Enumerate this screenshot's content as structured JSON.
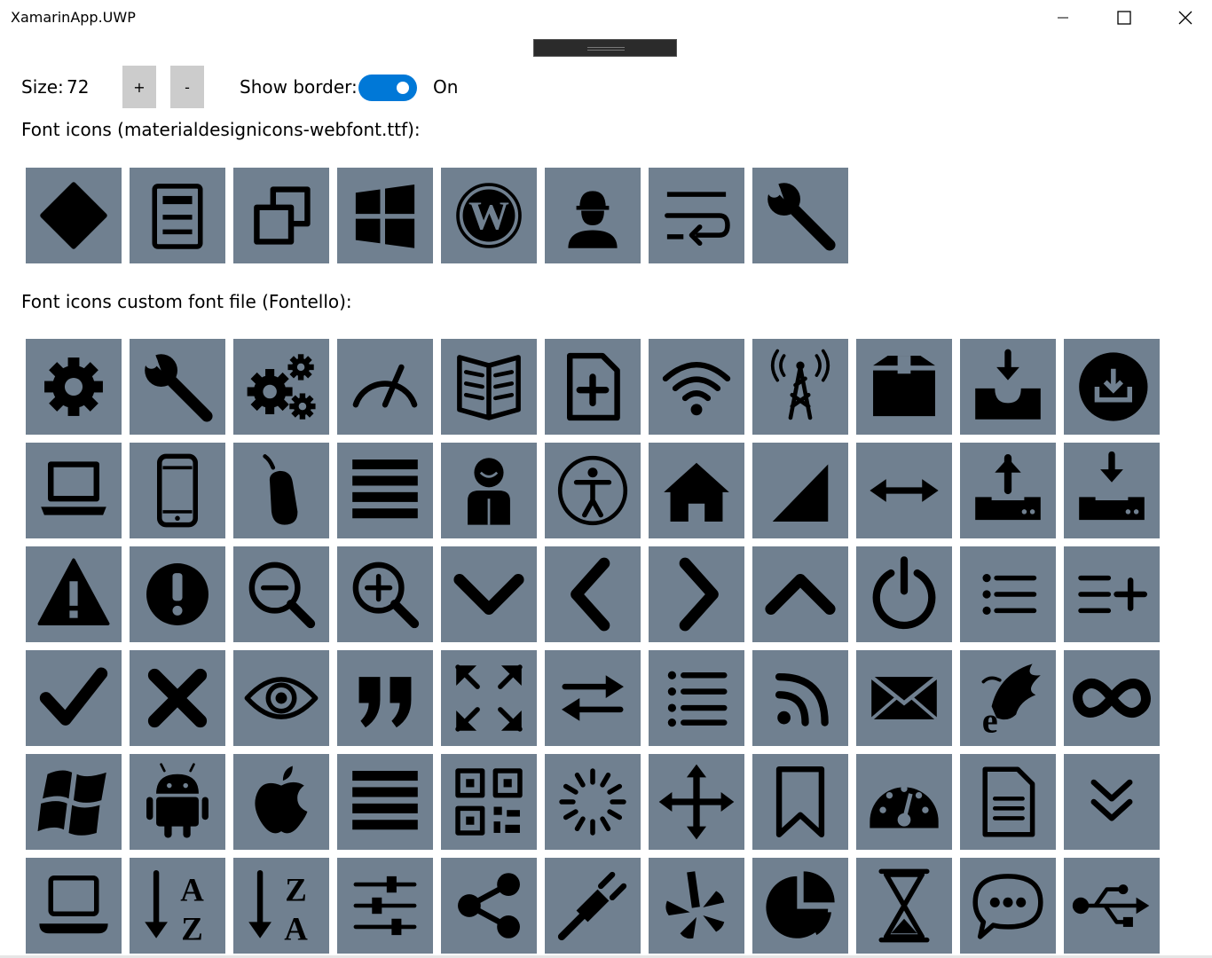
{
  "window": {
    "title": "XamarinApp.UWP"
  },
  "controls": {
    "size_label": "Size:",
    "size_value": "72",
    "plus_label": "+",
    "minus_label": "-",
    "border_label": "Show border:",
    "toggle_state": "On"
  },
  "sections": {
    "material_label": "Font icons (materialdesignicons-webfont.ttf):",
    "fontello_label": "Font icons custom font file (Fontello):"
  },
  "colors": {
    "tile_bg": "#708090",
    "toggle_on": "#0078d7",
    "icon": "#000000"
  },
  "material_icons": [
    "diamond",
    "locker",
    "window-restore",
    "windows",
    "wordpress",
    "worker",
    "wrap",
    "wrench"
  ],
  "fontello_icons": [
    [
      "cog",
      "wrench",
      "cogs",
      "gauge",
      "book-open",
      "doc-add",
      "wifi",
      "antenna",
      "box",
      "download-tray",
      "download-circle"
    ],
    [
      "laptop",
      "mobile",
      "mouse",
      "menu",
      "user",
      "accessibility",
      "home",
      "signal",
      "resize-horizontal",
      "upload-drive",
      "download-drive"
    ],
    [
      "warning",
      "exclamation",
      "zoom-out",
      "zoom-in",
      "chevron-down",
      "chevron-left",
      "chevron-right",
      "chevron-up",
      "power",
      "list",
      "list-add"
    ],
    [
      "check",
      "cancel",
      "eye",
      "quote",
      "fullscreen",
      "exchange",
      "list-bullets",
      "rss",
      "mail",
      "ie",
      "infinity"
    ],
    [
      "windows",
      "android",
      "apple",
      "menu-bars",
      "qrcode",
      "spinner",
      "move",
      "bookmark",
      "dashboard",
      "doc-text",
      "double-chevron-down"
    ],
    [
      "laptop-outline",
      "sort-alpha-asc",
      "sort-alpha-desc",
      "sliders",
      "share",
      "plug",
      "yelp",
      "chart-pie",
      "hourglass",
      "chat",
      "usb"
    ]
  ]
}
